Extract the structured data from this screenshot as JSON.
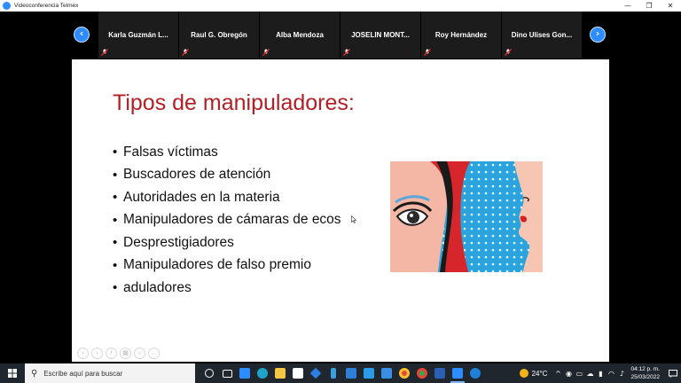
{
  "window": {
    "title": "Videoconferencia Telmex",
    "minimize": "—",
    "maximize": "❐",
    "close": "✕"
  },
  "participants": [
    {
      "name": "Karla Guzmán L..."
    },
    {
      "name": "Raul G. Obregón"
    },
    {
      "name": "Alba Mendoza"
    },
    {
      "name": "JOSELIN MONT..."
    },
    {
      "name": "Roy Hernández"
    },
    {
      "name": "Dino Ulises Gon..."
    }
  ],
  "nav": {
    "prev": "‹",
    "next": "›"
  },
  "slide": {
    "title": "Tipos de manipuladores:",
    "bullets": [
      "Falsas víctimas",
      "Buscadores de atención",
      "Autoridades en la materia",
      "Manipuladores de cámaras de ecos",
      "Desprestigiadores",
      "Manipuladores de falso premio",
      "aduladores"
    ]
  },
  "taskbar": {
    "search_placeholder": "Escribe aquí para buscar",
    "weather_temp": "24°C",
    "time": "04:12 p. m.",
    "date": "25/03/2022"
  },
  "colors": {
    "accent": "#2d8cff",
    "title_red": "#b21f24",
    "taskbar": "#20262e"
  }
}
